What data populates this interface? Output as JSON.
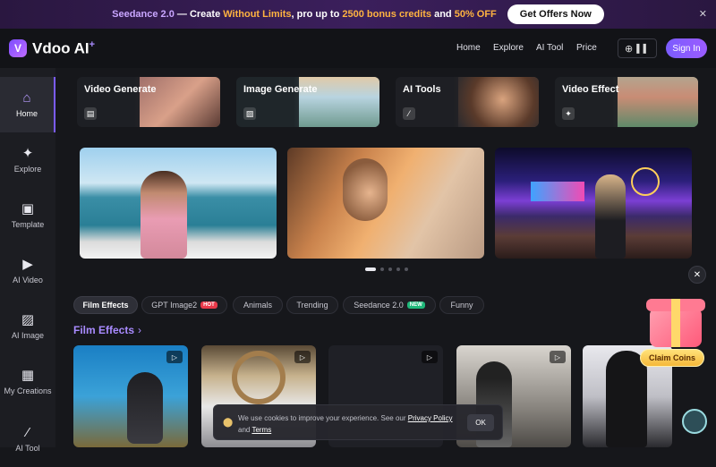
{
  "promo": {
    "part1": "Seedance 2.0",
    "part2": " — Create ",
    "part3": "Without Limits",
    "part4": ", pro up to ",
    "part5": "2500 bonus credits",
    "part6": " and ",
    "part7": "50% OFF",
    "button": "Get Offers Now"
  },
  "brand": {
    "name": "Vdoo AI"
  },
  "nav": {
    "home": "Home",
    "explore": "Explore",
    "ai_tool": "AI Tool",
    "price": "Price",
    "sign_in": "Sign In"
  },
  "sidebar": [
    {
      "label": "Home",
      "icon": "home-icon"
    },
    {
      "label": "Explore",
      "icon": "sparkle-icon"
    },
    {
      "label": "Template",
      "icon": "template-icon"
    },
    {
      "label": "AI Video",
      "icon": "video-icon"
    },
    {
      "label": "AI Image",
      "icon": "image-icon"
    },
    {
      "label": "My Creations",
      "icon": "grid-icon"
    },
    {
      "label": "AI Tool",
      "icon": "wand-icon"
    }
  ],
  "top_cards": [
    {
      "title": "Video Generate"
    },
    {
      "title": "Image Generate"
    },
    {
      "title": "AI Tools"
    },
    {
      "title": "Video Effect"
    }
  ],
  "carousel": {
    "slide_count": 5,
    "active_index": 0
  },
  "tabs": [
    {
      "label": "Film Effects",
      "active": true
    },
    {
      "label": "GPT Image2",
      "badge": "HOT"
    },
    {
      "label": "Animals"
    },
    {
      "label": "Trending"
    },
    {
      "label": "Seedance 2.0",
      "badge": "NEW"
    },
    {
      "label": "Funny"
    }
  ],
  "section": {
    "title": "Film Effects"
  },
  "cookie": {
    "text1": "We use cookies to improve your experience. See our ",
    "privacy": "Privacy Policy",
    "and": "and ",
    "terms": "Terms",
    "ok": "OK"
  },
  "gift": {
    "claim": "Claim Coins"
  },
  "colors": {
    "accent": "#7b5cff",
    "promo_highlight": "#ffb340",
    "hot_badge": "#e8394a",
    "new_badge": "#1fb87a"
  }
}
